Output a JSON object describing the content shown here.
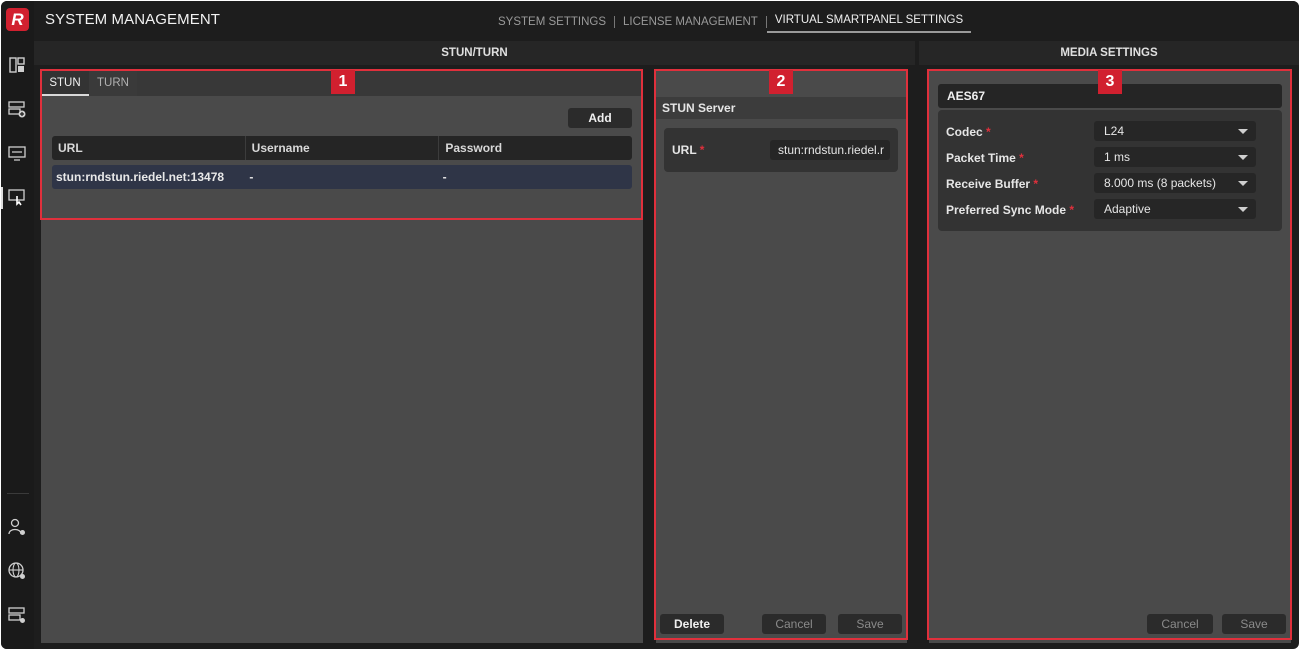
{
  "app": {
    "logo_letter": "R",
    "title": "SYSTEM MANAGEMENT"
  },
  "nav": {
    "items": [
      {
        "label": "SYSTEM SETTINGS"
      },
      {
        "label": "LICENSE MANAGEMENT"
      },
      {
        "label": "VIRTUAL SMARTPANEL SETTINGS",
        "active": true
      }
    ]
  },
  "rail": {
    "top_icons": [
      "dashboard-icon",
      "device-add-icon",
      "monitor-settings-icon",
      "touch-panel-icon"
    ],
    "bottom_icons": [
      "user-settings-icon",
      "globe-settings-icon",
      "server-settings-icon"
    ]
  },
  "sections": {
    "stun_turn": "STUN/TURN",
    "media": "MEDIA SETTINGS"
  },
  "badges": [
    "1",
    "2",
    "3"
  ],
  "stun_list": {
    "tabs": [
      {
        "label": "STUN",
        "active": true
      },
      {
        "label": "TURN"
      }
    ],
    "add_label": "Add",
    "columns": [
      "URL",
      "Username",
      "Password"
    ],
    "rows": [
      [
        "stun:rndstun.riedel.net:13478",
        "-",
        "-"
      ]
    ]
  },
  "stun_server": {
    "header": "STUN Server",
    "url_label": "URL",
    "required_mark": "*",
    "url_value": "stun:rndstun.riedel.r",
    "delete_label": "Delete",
    "cancel_label": "Cancel",
    "save_label": "Save"
  },
  "media": {
    "header": "AES67",
    "required_mark": "*",
    "fields": [
      {
        "label": "Codec",
        "value": "L24"
      },
      {
        "label": "Packet Time",
        "value": "1 ms"
      },
      {
        "label": "Receive Buffer",
        "value": "8.000 ms (8 packets)"
      },
      {
        "label": "Preferred Sync Mode",
        "value": "Adaptive"
      }
    ],
    "cancel_label": "Cancel",
    "save_label": "Save"
  },
  "colors": {
    "accent_red": "#d1202f",
    "selected_row": "#2f3547",
    "panel_bg": "#4a4a4a"
  }
}
